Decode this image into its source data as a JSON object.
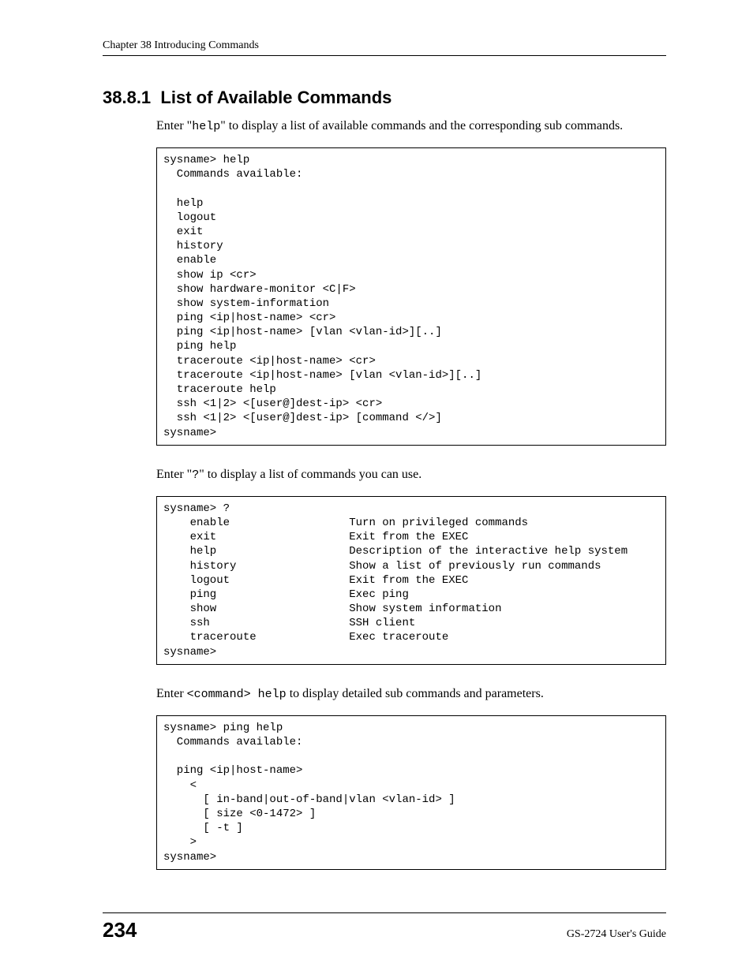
{
  "header": {
    "chapter": "Chapter 38 Introducing Commands"
  },
  "section": {
    "number": "38.8.1",
    "title": "List of Available Commands"
  },
  "para1_a": "Enter \"",
  "para1_mono": "help",
  "para1_b": "\" to display a list of available commands and the corresponding sub commands.",
  "code1": "sysname> help\n  Commands available:\n\n  help\n  logout\n  exit\n  history\n  enable\n  show ip <cr>\n  show hardware-monitor <C|F>\n  show system-information\n  ping <ip|host-name> <cr>\n  ping <ip|host-name> [vlan <vlan-id>][..]\n  ping help\n  traceroute <ip|host-name> <cr>\n  traceroute <ip|host-name> [vlan <vlan-id>][..]\n  traceroute help\n  ssh <1|2> <[user@]dest-ip> <cr>\n  ssh <1|2> <[user@]dest-ip> [command </>]\nsysname>",
  "para2_a": "Enter \"",
  "para2_mono": "?",
  "para2_b": "\" to display a list of commands you can use.",
  "code2": "sysname> ?\n    enable                  Turn on privileged commands\n    exit                    Exit from the EXEC\n    help                    Description of the interactive help system\n    history                 Show a list of previously run commands\n    logout                  Exit from the EXEC\n    ping                    Exec ping\n    show                    Show system information\n    ssh                     SSH client\n    traceroute              Exec traceroute\nsysname>",
  "para3_a": "Enter ",
  "para3_mono": "<command> help",
  "para3_b": " to display detailed sub commands and parameters.",
  "code3": "sysname> ping help\n  Commands available:\n\n  ping <ip|host-name>\n    <\n      [ in-band|out-of-band|vlan <vlan-id> ]\n      [ size <0-1472> ]\n      [ -t ]\n    >\nsysname>",
  "footer": {
    "page": "234",
    "guide": "GS-2724 User's Guide"
  }
}
